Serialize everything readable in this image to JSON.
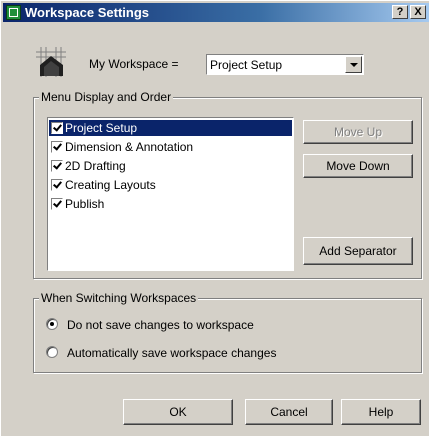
{
  "window": {
    "title": "Workspace Settings",
    "help_button": "?",
    "close_button": "X"
  },
  "workspace": {
    "label": "My Workspace =",
    "selected": "Project Setup"
  },
  "menu_group": {
    "title": "Menu Display and Order",
    "items": [
      {
        "label": "Project Setup",
        "checked": true,
        "selected": true
      },
      {
        "label": "Dimension & Annotation",
        "checked": true,
        "selected": false
      },
      {
        "label": "2D Drafting",
        "checked": true,
        "selected": false
      },
      {
        "label": "Creating Layouts",
        "checked": true,
        "selected": false
      },
      {
        "label": "Publish",
        "checked": true,
        "selected": false
      }
    ],
    "move_up": "Move Up",
    "move_down": "Move Down",
    "add_separator": "Add Separator"
  },
  "switching_group": {
    "title": "When Switching Workspaces",
    "option_no_save": "Do not save changes to workspace",
    "option_auto_save": "Automatically save workspace changes",
    "selected_option": "option_no_save"
  },
  "footer": {
    "ok": "OK",
    "cancel": "Cancel",
    "help": "Help"
  },
  "colors": {
    "title_bar": "#0a246a",
    "face": "#d4d0c8",
    "selection": "#0a246a"
  }
}
